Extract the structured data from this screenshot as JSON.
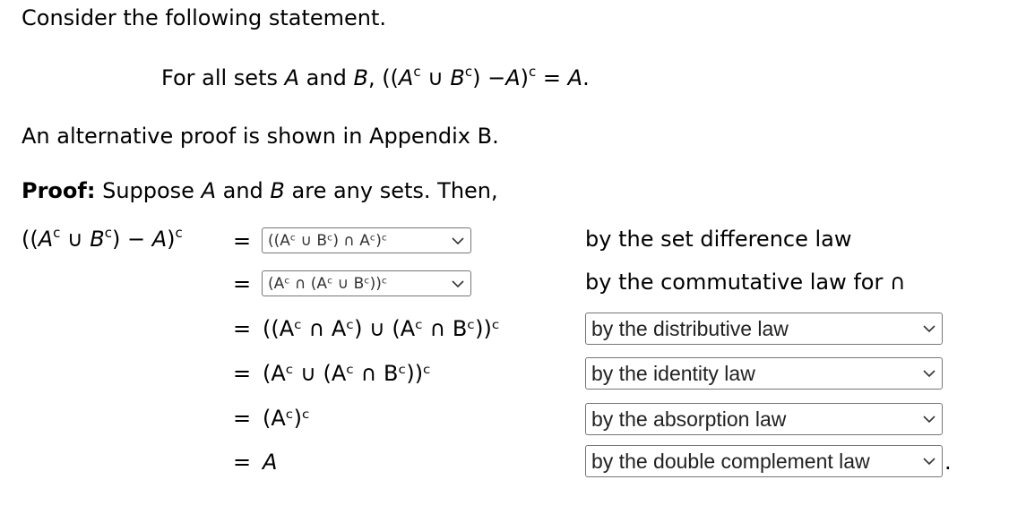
{
  "intro": "Consider the following statement.",
  "statement": {
    "prefix": "For all sets ",
    "var_a": "A",
    "and": " and ",
    "var_b": "B",
    "comma": ", ((",
    "A": "A",
    "c": "c",
    "union": " ∪ ",
    "B": "B",
    "close_minus": ") −",
    "close": ")",
    "equals": " = ",
    "result": "A",
    "period": "."
  },
  "alt_note": "An alternative proof is shown in Appendix B.",
  "proof": {
    "label": "Proof:",
    "text1": " Suppose ",
    "a": "A",
    "text2": " and ",
    "b": "B",
    "text3": " are any sets. Then,"
  },
  "lhs": {
    "open": "((",
    "A": "A",
    "c": "c",
    "union": " ∪ ",
    "B": "B",
    "minus": ") − ",
    "A2": "A",
    "close": ")"
  },
  "equals_sign": "=",
  "steps": [
    {
      "expression_select": "((Aᶜ ∪ Bᶜ) ∩ Aᶜ)ᶜ",
      "reason": "by the set difference law",
      "reason_is_select": false
    },
    {
      "expression_select": "(Aᶜ ∩ (Aᶜ ∪ Bᶜ))ᶜ",
      "reason": "by the commutative law for ∩",
      "reason_is_select": false
    },
    {
      "expression": "((Aᶜ ∩ Aᶜ) ∪ (Aᶜ ∩ Bᶜ))ᶜ",
      "reason": "by the distributive law",
      "reason_is_select": true
    },
    {
      "expression": "(Aᶜ ∪ (Aᶜ ∩ Bᶜ))ᶜ",
      "reason": "by the identity law",
      "reason_is_select": true
    },
    {
      "expression": "(Aᶜ)ᶜ",
      "reason": "by the absorption law",
      "reason_is_select": true
    },
    {
      "expression": "A",
      "reason": "by the double complement law",
      "reason_is_select": true
    }
  ],
  "final_period": "."
}
